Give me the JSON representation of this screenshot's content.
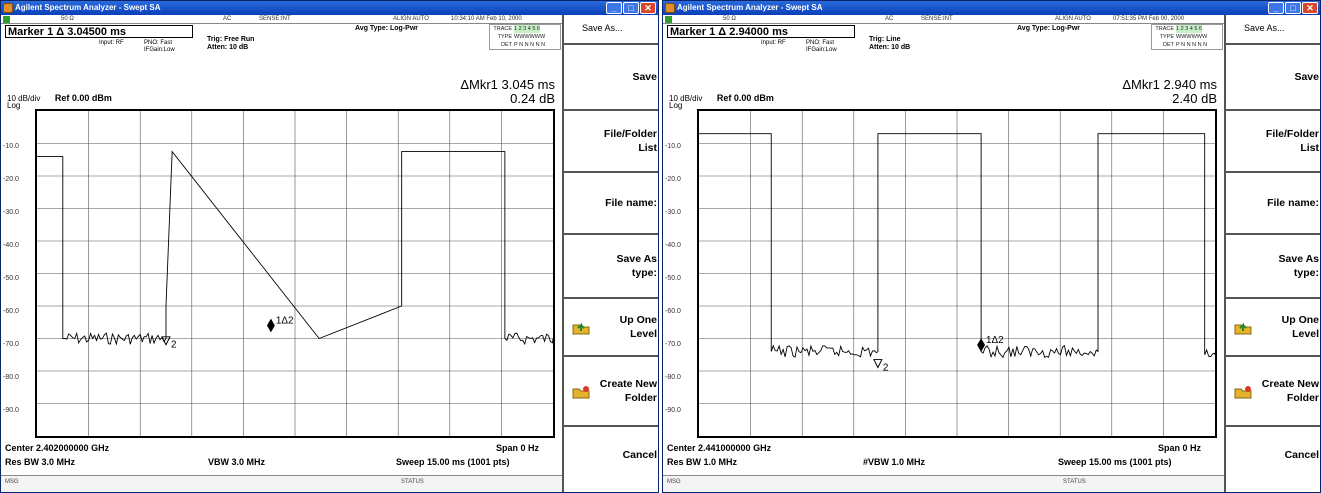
{
  "windows": [
    {
      "title": "Agilent Spectrum Analyzer - Swept SA",
      "status": {
        "impedance": "50 Ω",
        "coupling": "AC",
        "sense": "SENSE:INT",
        "align": "ALIGN AUTO",
        "datetime": "10:34:10 AM Feb 10, 2000"
      },
      "marker_label": "Marker 1 Δ  3.04500 ms",
      "input": "Input: RF",
      "pno": "PNO: Fast",
      "ifgain": "IFGain:Low",
      "trig": "Trig: Free Run",
      "atten": "Atten: 10 dB",
      "avg_type": "Avg Type: Log-Pwr",
      "trace": {
        "trace_lbl": "TRACE",
        "trace_val": "1 2 3 4 5 6",
        "type_lbl": "TYPE",
        "type_val": "WWWWWW",
        "det_lbl": "DET",
        "det_val": "P N N N N N"
      },
      "mkr_readout_1": "ΔMkr1 3.045 ms",
      "mkr_readout_2": "0.24 dB",
      "scale": "10 dB/div",
      "ref": "Ref 0.00 dBm",
      "log": "Log",
      "y_ticks": [
        "-10.0",
        "-20.0",
        "-30.0",
        "-40.0",
        "-50.0",
        "-60.0",
        "-70.0",
        "-80.0",
        "-90.0"
      ],
      "marker_tag": "1Δ2",
      "marker_tag_2": "2",
      "center": "Center 2.402000000 GHz",
      "span": "Span 0 Hz",
      "res_bw": "Res BW 3.0 MHz",
      "vbw": "VBW 3.0 MHz",
      "sweep": "Sweep  15.00 ms (1001 pts)",
      "msg": "MSG",
      "status_lbl": "STATUS",
      "softkeys": [
        "Save As...",
        "Save",
        "File/Folder\nList",
        "File name:",
        "Save As\ntype:",
        "Up One\nLevel",
        "Create New\nFolder",
        "Cancel"
      ]
    },
    {
      "title": "Agilent Spectrum Analyzer - Swept SA",
      "status": {
        "impedance": "50 Ω",
        "coupling": "AC",
        "sense": "SENSE:INT",
        "align": "ALIGN AUTO",
        "datetime": "07:51:35 PM Feb 00, 2000"
      },
      "marker_label": "Marker 1 Δ  2.94000 ms",
      "input": "Input: RF",
      "pno": "PNO: Fast",
      "ifgain": "IFGain:Low",
      "trig": "Trig: Line",
      "atten": "Atten: 10 dB",
      "avg_type": "Avg Type: Log-Pwr",
      "trace": {
        "trace_lbl": "TRACE",
        "trace_val": "1 2 3 4 5 6",
        "type_lbl": "TYPE",
        "type_val": "WWWWWW",
        "det_lbl": "DET",
        "det_val": "P N N N N N"
      },
      "mkr_readout_1": "ΔMkr1 2.940 ms",
      "mkr_readout_2": "2.40 dB",
      "scale": "10 dB/div",
      "ref": "Ref 0.00 dBm",
      "log": "Log",
      "y_ticks": [
        "-10.0",
        "-20.0",
        "-30.0",
        "-40.0",
        "-50.0",
        "-60.0",
        "-70.0",
        "-80.0",
        "-90.0"
      ],
      "marker_tag": "1Δ2",
      "marker_tag_2": "2",
      "center": "Center 2.441000000 GHz",
      "span": "Span 0 Hz",
      "res_bw": "Res BW 1.0 MHz",
      "vbw": "#VBW 1.0 MHz",
      "sweep": "Sweep  15.00 ms (1001 pts)",
      "msg": "MSG",
      "status_lbl": "STATUS",
      "softkeys": [
        "Save As...",
        "Save",
        "File/Folder\nList",
        "File name:",
        "Save As\ntype:",
        "Up One\nLevel",
        "Create New\nFolder",
        "Cancel"
      ]
    }
  ],
  "chart_data": [
    {
      "type": "line",
      "title": "",
      "xlabel": "",
      "ylabel": "",
      "x_unit": "ms",
      "y_unit": "dBm",
      "xlim": [
        0,
        15
      ],
      "ylim": [
        -100,
        0
      ],
      "grid": true,
      "series": [
        {
          "x": [
            0,
            0.75,
            0.75,
            3.75,
            3.75,
            3.93,
            3.93,
            8.2,
            8.2,
            10.6,
            10.6,
            13.6,
            13.6,
            15
          ],
          "y": [
            -14,
            -14,
            -70,
            -70,
            -60,
            -12.5,
            -12.5,
            -70,
            -70,
            -60,
            -12.5,
            -12.5,
            -70,
            -70
          ]
        }
      ],
      "markers": [
        {
          "label": "1Δ2",
          "x_ms": 6.8,
          "y": -66
        },
        {
          "label": "2",
          "x_ms": 3.75,
          "y": -71
        }
      ]
    },
    {
      "type": "line",
      "title": "",
      "xlabel": "",
      "ylabel": "",
      "x_unit": "ms",
      "y_unit": "dBm",
      "xlim": [
        0,
        15
      ],
      "ylim": [
        -100,
        0
      ],
      "grid": true,
      "series": [
        {
          "x": [
            0,
            2.1,
            2.1,
            5.2,
            5.2,
            8.2,
            8.2,
            11.6,
            11.6,
            14.7,
            14.7,
            15
          ],
          "y": [
            -7,
            -7,
            -74,
            -74,
            -7,
            -7,
            -74,
            -74,
            -7,
            -7,
            -75,
            -75
          ]
        }
      ],
      "markers": [
        {
          "label": "1Δ2",
          "x_ms": 8.2,
          "y": -72
        },
        {
          "label": "2",
          "x_ms": 5.2,
          "y": -78
        }
      ]
    }
  ],
  "colors": {
    "titlebar": "#0a3fb8",
    "trace": "#000000",
    "grid": "#000000",
    "folder": "#e3b32b"
  },
  "icons": {
    "folder_up": "folder-up-icon",
    "folder_new": "folder-new-icon"
  }
}
